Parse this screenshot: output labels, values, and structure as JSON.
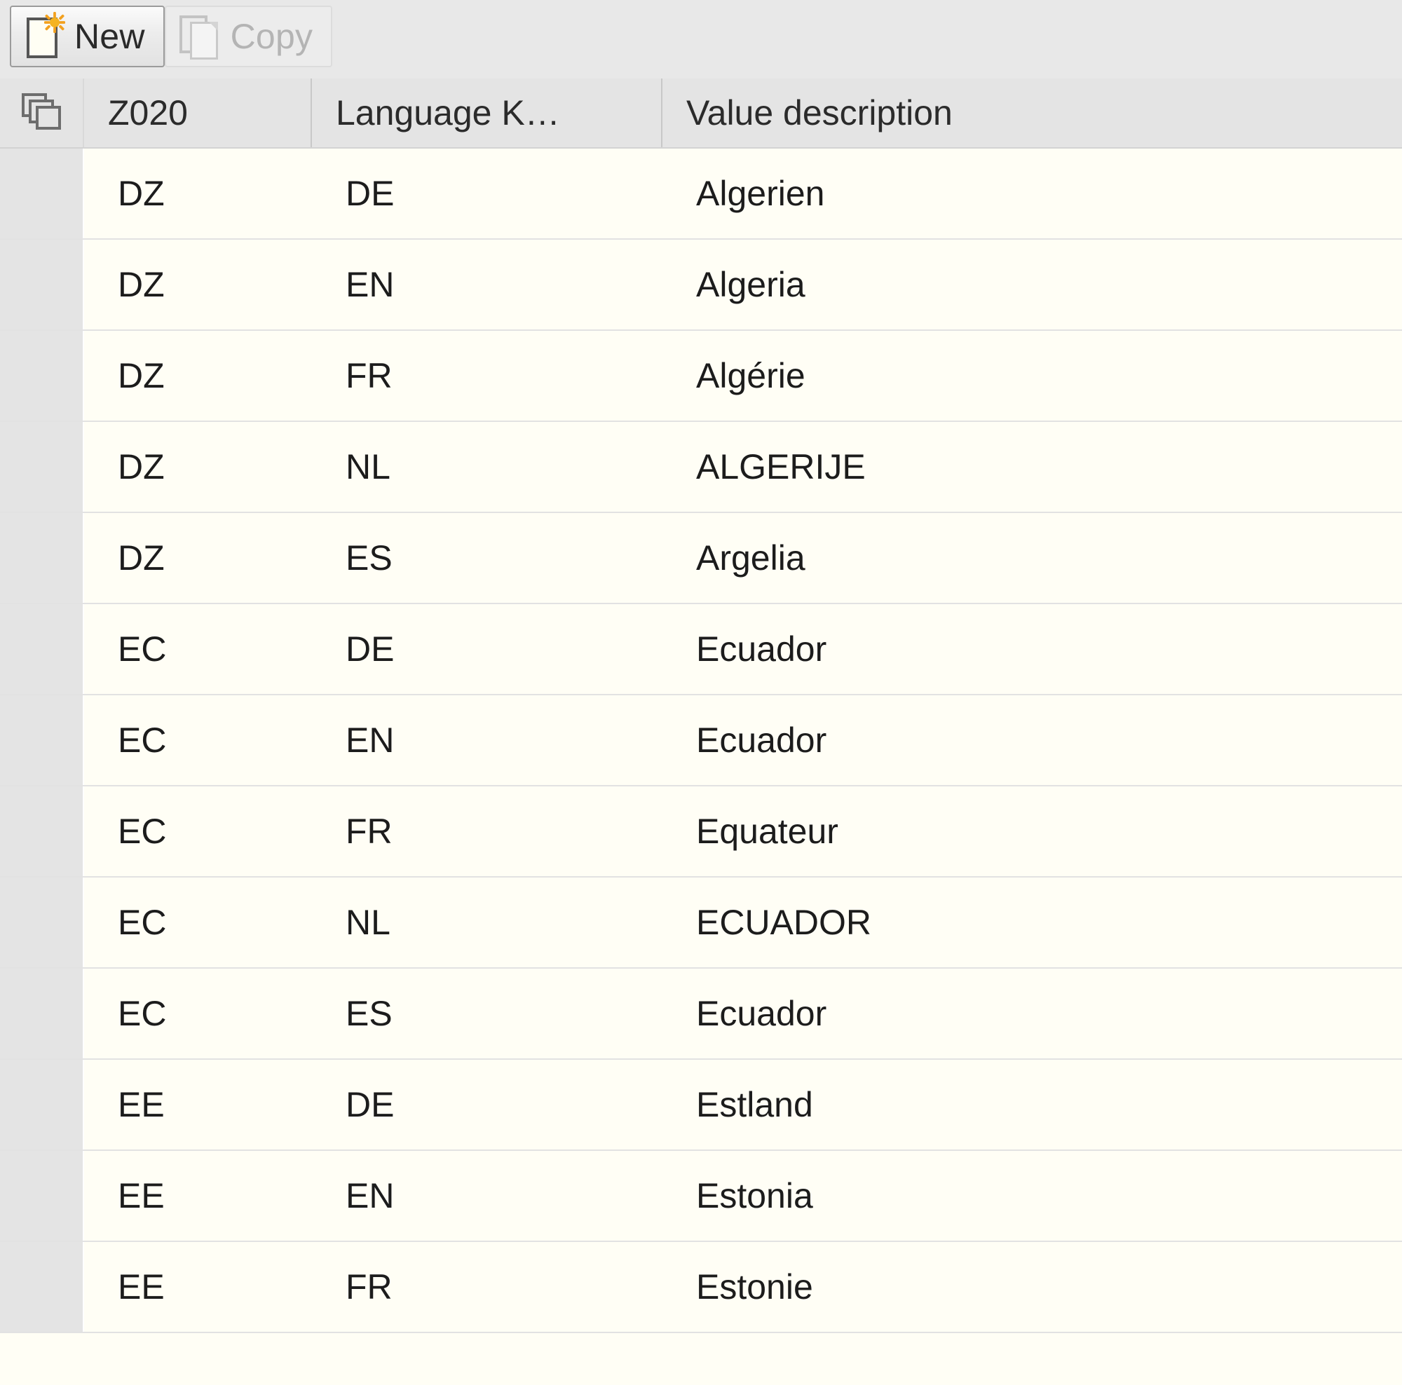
{
  "toolbar": {
    "buttons": [
      {
        "label": "New",
        "icon": "new-document-icon",
        "enabled": true
      },
      {
        "label": "Copy",
        "icon": "copy-document-icon",
        "enabled": false
      }
    ]
  },
  "grid": {
    "select_all_icon": "stacked-rows-icon",
    "columns": [
      {
        "key": "code",
        "label": "Z020"
      },
      {
        "key": "language",
        "label": "Language K…"
      },
      {
        "key": "value",
        "label": "Value description"
      }
    ],
    "rows": [
      {
        "code": "DZ",
        "language": "DE",
        "value": "Algerien"
      },
      {
        "code": "DZ",
        "language": "EN",
        "value": "Algeria"
      },
      {
        "code": "DZ",
        "language": "FR",
        "value": "Algérie"
      },
      {
        "code": "DZ",
        "language": "NL",
        "value": "ALGERIJE"
      },
      {
        "code": "DZ",
        "language": "ES",
        "value": "Argelia"
      },
      {
        "code": "EC",
        "language": "DE",
        "value": "Ecuador"
      },
      {
        "code": "EC",
        "language": "EN",
        "value": "Ecuador"
      },
      {
        "code": "EC",
        "language": "FR",
        "value": "Equateur"
      },
      {
        "code": "EC",
        "language": "NL",
        "value": "ECUADOR"
      },
      {
        "code": "EC",
        "language": "ES",
        "value": "Ecuador"
      },
      {
        "code": "EE",
        "language": "DE",
        "value": "Estland"
      },
      {
        "code": "EE",
        "language": "EN",
        "value": "Estonia"
      },
      {
        "code": "EE",
        "language": "FR",
        "value": "Estonie"
      }
    ]
  },
  "colors": {
    "toolbar_bg": "#e8e8e8",
    "header_bg": "#e4e4e4",
    "row_bg": "#fffef5",
    "selector_bg": "#e4e4e4",
    "text": "#1c1c1c",
    "disabled_text": "#b4b4b4",
    "accent_star": "#f5a623"
  }
}
